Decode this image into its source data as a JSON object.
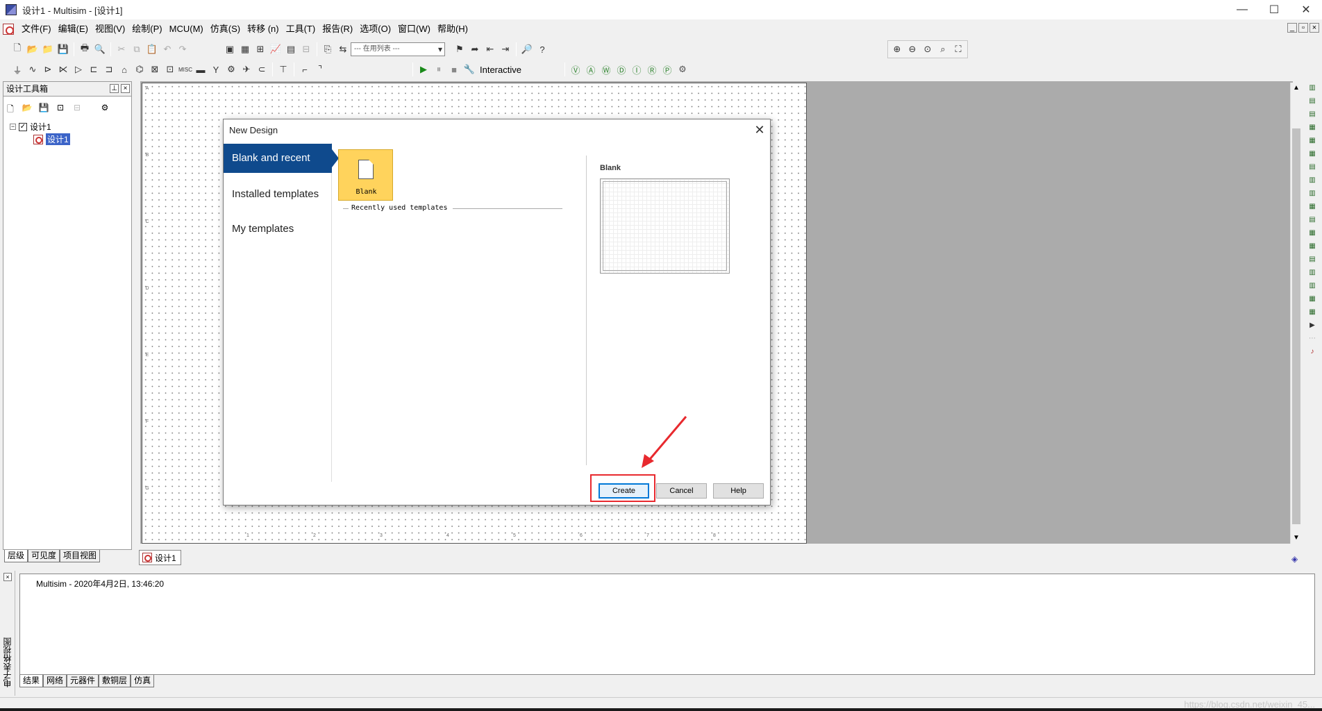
{
  "window": {
    "title": "设计1 - Multisim - [设计1]",
    "min_glyph": "—",
    "max_glyph": "☐",
    "close_glyph": "✕"
  },
  "menu": [
    "文件(F)",
    "编辑(E)",
    "视图(V)",
    "绘制(P)",
    "MCU(M)",
    "仿真(S)",
    "转移 (n)",
    "工具(T)",
    "报告(R)",
    "选项(O)",
    "窗口(W)",
    "帮助(H)"
  ],
  "toolbar": {
    "in_use_list": "--- 在用列表 ---",
    "interactive": "Interactive"
  },
  "toolbox": {
    "title": "设计工具箱",
    "tree_root": "设计1",
    "tree_child": "设计1",
    "tabs": [
      "层级",
      "可见度",
      "项目视图"
    ]
  },
  "canvas": {
    "tab_label": "设计1",
    "ruler_top": [
      "1",
      "2",
      "3",
      "4",
      "5",
      "6",
      "7",
      "8"
    ],
    "ruler_left": [
      "A",
      "B",
      "C",
      "D",
      "E",
      "F",
      "G"
    ]
  },
  "dialog": {
    "title": "New Design",
    "nav": [
      "Blank and recent",
      "Installed templates",
      "My templates"
    ],
    "blank_card_label": "Blank",
    "recent_label": "Recently used templates",
    "preview_title": "Blank",
    "buttons": {
      "create": "Create",
      "cancel": "Cancel",
      "help": "Help"
    },
    "close_glyph": "✕"
  },
  "output": {
    "side_label": "电子表格视图",
    "line": "Multisim  -  2020年4月2日, 13:46:20",
    "tabs": [
      "结果",
      "网络",
      "元器件",
      "敷铜层",
      "仿真"
    ]
  },
  "status": {
    "watermark": "https://blog.csdn.net/weixin_45..."
  },
  "colors": {
    "nav_active": "#0f4a8d",
    "blank_card": "#ffd35c",
    "highlight": "#e8292e",
    "create_border": "#0078d7"
  }
}
